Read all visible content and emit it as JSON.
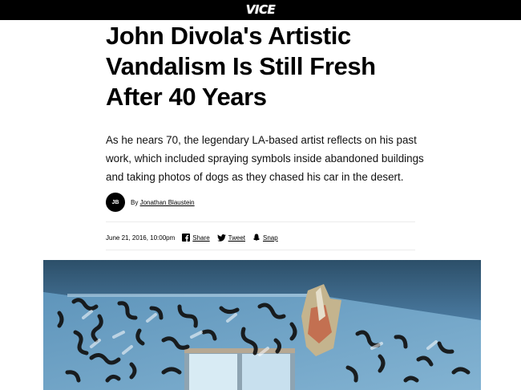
{
  "header": {
    "logo_text": "VICE",
    "bar_color": "#000000"
  },
  "article": {
    "headline": "John Divola's Artistic Vandalism Is Still Fresh After 40 Years",
    "dek": "As he nears 70, the legendary LA-based artist reflects on his past work, which included spraying symbols inside abandoned buildings and taking photos of dogs as they chased his car in the desert.",
    "byline": {
      "avatar_initials": "JB",
      "prefix": "By",
      "author": "Jonathan Blaustein"
    },
    "date": "June 21, 2016, 10:00pm",
    "share": [
      {
        "label": "Share",
        "icon": "facebook-icon"
      },
      {
        "label": "Tweet",
        "icon": "twitter-icon"
      },
      {
        "label": "Snap",
        "icon": "snapchat-icon"
      }
    ]
  },
  "hero_image": {
    "subject": "wall-with-spray-painted-black-squiggles",
    "wall_color": "#6fa3c7",
    "ceiling_color": "#37607e"
  }
}
